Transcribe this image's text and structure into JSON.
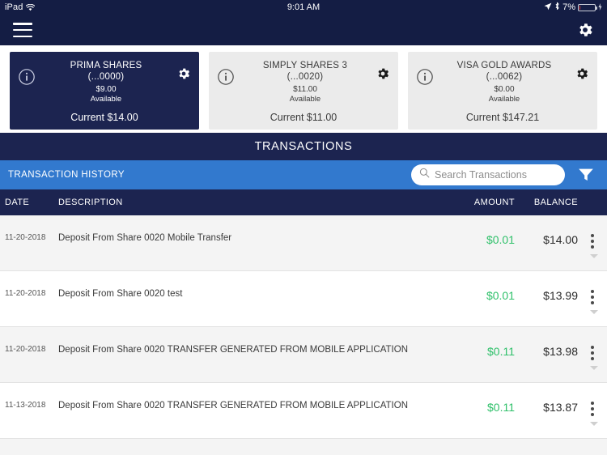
{
  "statusbar": {
    "carrier": "iPad",
    "wifi_icon": "wifi-icon",
    "time": "9:01 AM",
    "location_icon": "location-arrow-icon",
    "bluetooth_icon": "bluetooth-icon",
    "battery_percent": "7%",
    "battery_level": 7,
    "battery_color": "#e8413c",
    "charging_icon": "charging-bolt-icon"
  },
  "navbar": {
    "menu_icon": "hamburger-menu-icon",
    "settings_icon": "gear-icon",
    "background": "#141d44"
  },
  "accounts": [
    {
      "name": "PRIMA SHARES",
      "number": "(...0000)",
      "available_amount": "$9.00",
      "available_label": "Available",
      "current": "Current $14.00",
      "theme": "dark",
      "info_icon": "info-circle-icon",
      "settings_icon": "gear-icon"
    },
    {
      "name": "SIMPLY SHARES 3",
      "number": "(...0020)",
      "available_amount": "$11.00",
      "available_label": "Available",
      "current": "Current $11.00",
      "theme": "light",
      "info_icon": "info-circle-icon",
      "settings_icon": "gear-icon"
    },
    {
      "name": "VISA GOLD AWARDS",
      "number": "(...0062)",
      "available_amount": "$0.00",
      "available_label": "Available",
      "current": "Current $147.21",
      "theme": "light",
      "info_icon": "info-circle-icon",
      "settings_icon": "gear-icon"
    }
  ],
  "transactions_section": {
    "title": "TRANSACTIONS",
    "history_label": "TRANSACTION HISTORY",
    "search": {
      "placeholder": "Search Transactions",
      "value": "",
      "icon": "search-icon"
    },
    "filter_icon": "filter-funnel-icon",
    "accent_blue": "#3279ce",
    "navy": "#1c2450"
  },
  "table": {
    "columns": {
      "date": "DATE",
      "description": "DESCRIPTION",
      "amount": "AMOUNT",
      "balance": "BALANCE"
    },
    "rows": [
      {
        "date": "11-20-2018",
        "description": "Deposit From Share 0020 Mobile Transfer",
        "amount": "$0.01",
        "balance": "$14.00",
        "menu_icon": "kebab-menu-icon",
        "expand_icon": "chevron-down-icon"
      },
      {
        "date": "11-20-2018",
        "description": "Deposit From Share 0020 test",
        "amount": "$0.01",
        "balance": "$13.99",
        "menu_icon": "kebab-menu-icon",
        "expand_icon": "chevron-down-icon"
      },
      {
        "date": "11-20-2018",
        "description": "Deposit From Share 0020 TRANSFER GENERATED FROM MOBILE APPLICATION",
        "amount": "$0.11",
        "balance": "$13.98",
        "menu_icon": "kebab-menu-icon",
        "expand_icon": "chevron-down-icon"
      },
      {
        "date": "11-13-2018",
        "description": "Deposit From Share 0020 TRANSFER GENERATED FROM MOBILE APPLICATION",
        "amount": "$0.11",
        "balance": "$13.87",
        "menu_icon": "kebab-menu-icon",
        "expand_icon": "chevron-down-icon"
      }
    ],
    "amount_color": "#2fc06a"
  }
}
